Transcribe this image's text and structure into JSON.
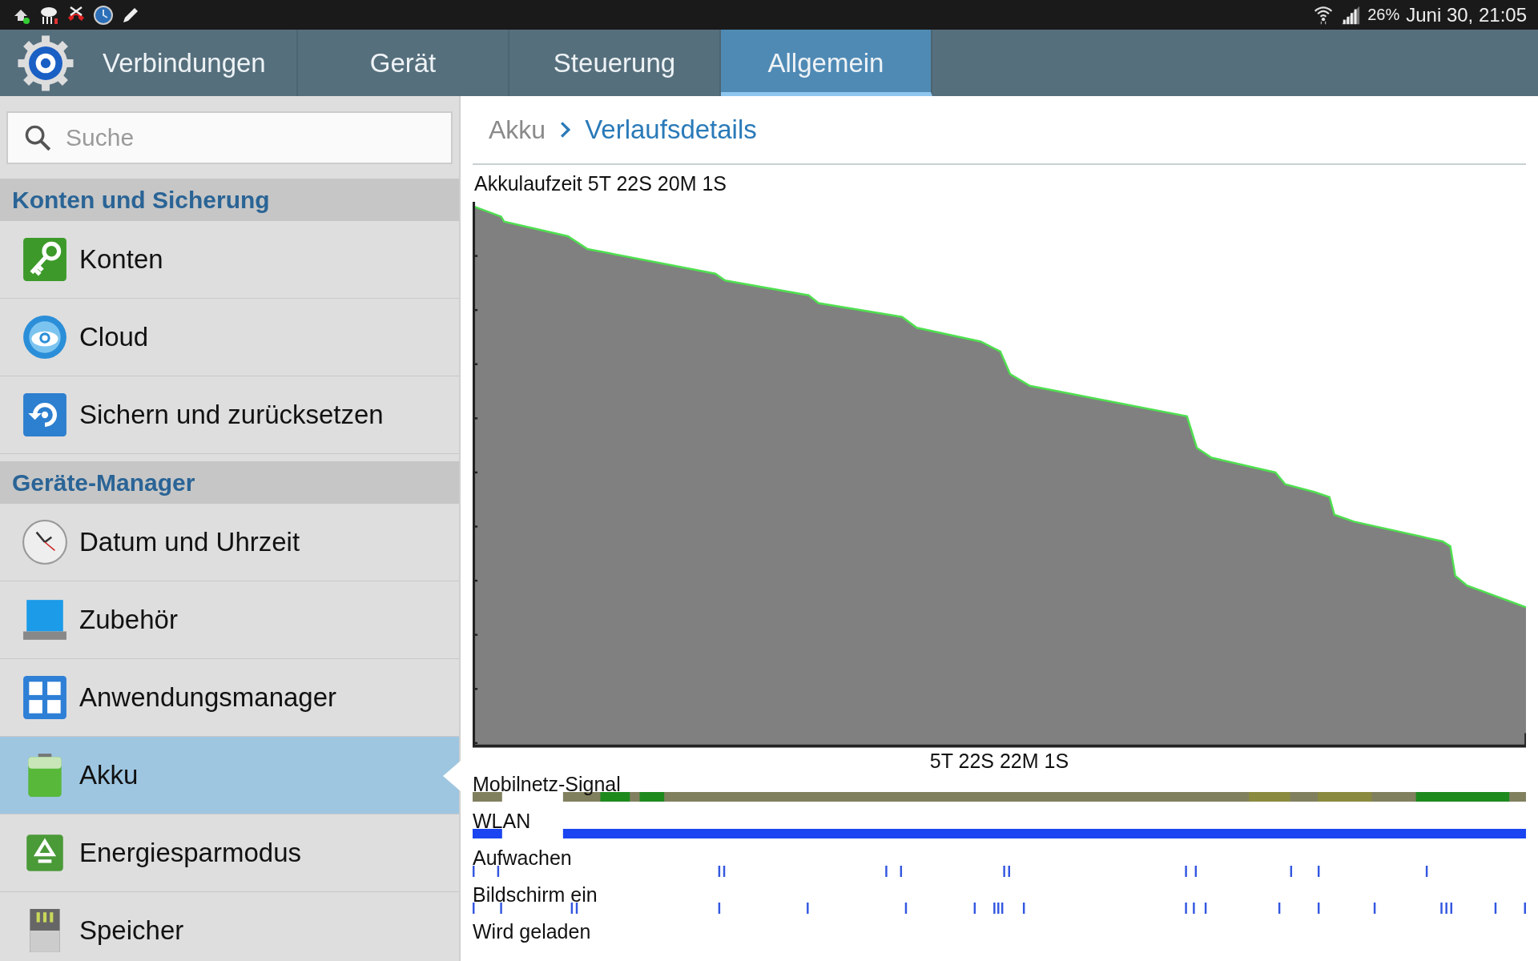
{
  "status_bar": {
    "battery": "26%",
    "datetime": "Juni 30, 21:05"
  },
  "tabs": [
    {
      "label": "Verbindungen",
      "selected": false
    },
    {
      "label": "Gerät",
      "selected": false
    },
    {
      "label": "Steuerung",
      "selected": false
    },
    {
      "label": "Allgemein",
      "selected": true
    }
  ],
  "search": {
    "placeholder": "Suche"
  },
  "sidebar": {
    "sections": [
      {
        "title": "Konten und Sicherung",
        "items": [
          {
            "label": "Konten",
            "selected": false
          },
          {
            "label": "Cloud",
            "selected": false
          },
          {
            "label": "Sichern und zurücksetzen",
            "selected": false
          }
        ]
      },
      {
        "title": "Geräte-Manager",
        "items": [
          {
            "label": "Datum und Uhrzeit",
            "selected": false
          },
          {
            "label": "Zubehör",
            "selected": false
          },
          {
            "label": "Anwendungsmanager",
            "selected": false
          },
          {
            "label": "Akku",
            "selected": true
          },
          {
            "label": "Energiesparmodus",
            "selected": false
          },
          {
            "label": "Speicher",
            "selected": false
          }
        ]
      }
    ]
  },
  "breadcrumb": {
    "parent": "Akku",
    "current": "Verlaufsdetails"
  },
  "battery_chart": {
    "title": "Akkulaufzeit 5T 22S 20M 1S",
    "time_label": "5T 22S 22M 1S"
  },
  "timelines": [
    {
      "label": "Mobilnetz-Signal",
      "kind": "signal"
    },
    {
      "label": "WLAN",
      "kind": "bar"
    },
    {
      "label": "Aufwachen",
      "kind": "ticks"
    },
    {
      "label": "Bildschirm ein",
      "kind": "ticks"
    },
    {
      "label": "Wird geladen",
      "kind": "none"
    }
  ]
}
